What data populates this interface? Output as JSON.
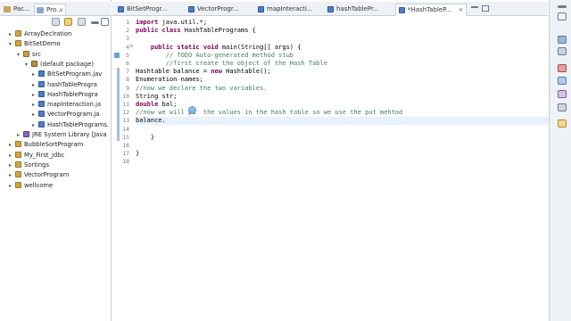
{
  "left_tabs": [
    {
      "label": "Pac..."
    },
    {
      "label": "Pro..."
    }
  ],
  "tree": [
    {
      "label": "ArrayDeclration",
      "level": 0,
      "arrow": "▸",
      "type": "proj"
    },
    {
      "label": "BitSetDemo",
      "level": 0,
      "arrow": "▾",
      "type": "proj"
    },
    {
      "label": "src",
      "level": 1,
      "arrow": "▾",
      "type": "src"
    },
    {
      "label": "(default package)",
      "level": 2,
      "arrow": "▾",
      "type": "pkg"
    },
    {
      "label": "BitSetProgram.jav",
      "level": 3,
      "arrow": "▸",
      "type": "java"
    },
    {
      "label": "hashTableProgra",
      "level": 3,
      "arrow": "▸",
      "type": "java"
    },
    {
      "label": "HashTableProgra",
      "level": 3,
      "arrow": "▸",
      "type": "java"
    },
    {
      "label": "mapInteraction.ja",
      "level": 3,
      "arrow": "▸",
      "type": "java"
    },
    {
      "label": "VectorProgram.ja",
      "level": 3,
      "arrow": "▸",
      "type": "java"
    },
    {
      "label": "HashTablePrograms.",
      "level": 3,
      "arrow": "▸",
      "type": "java"
    },
    {
      "label": "JRE System Library [Java",
      "level": 1,
      "arrow": "▸",
      "type": "lib"
    },
    {
      "label": "BubbleSortProgram",
      "level": 0,
      "arrow": "▸",
      "type": "proj"
    },
    {
      "label": "My_First_jdbc",
      "level": 0,
      "arrow": "▸",
      "type": "proj"
    },
    {
      "label": "Sortings",
      "level": 0,
      "arrow": "▸",
      "type": "proj"
    },
    {
      "label": "VectorProgram",
      "level": 0,
      "arrow": "▸",
      "type": "proj"
    },
    {
      "label": "wellcome",
      "level": 0,
      "arrow": "▸",
      "type": "proj"
    }
  ],
  "editor_tabs": [
    {
      "label": "BitSetProgr...",
      "active": false
    },
    {
      "label": "VectorProgr...",
      "active": false
    },
    {
      "label": "mapInteracti...",
      "active": false
    },
    {
      "label": "hashTablePr...",
      "active": false
    },
    {
      "label": "*HashTableP...",
      "active": true
    }
  ],
  "code_lines": [
    {
      "n": "1",
      "html": "<span class=\"kw\">import</span> java.util.*;"
    },
    {
      "n": "2",
      "html": "<span class=\"kw\">public class</span> HashTablePrograms {"
    },
    {
      "n": "3",
      "html": ""
    },
    {
      "n": "4",
      "html": "    <span class=\"kw\">public static void</span> main(String[] args) {"
    },
    {
      "n": "5",
      "html": "        <span class=\"cm\">// TODO Auto-generated method stub</span>"
    },
    {
      "n": "6",
      "html": "        <span class=\"cm\">//first create the object of the Hash Table</span>"
    },
    {
      "n": "7",
      "html": "Hashtable balance = <span class=\"kw\">new</span> Hashtable();"
    },
    {
      "n": "8",
      "html": "Enumeration names;"
    },
    {
      "n": "9",
      "html": "<span class=\"cm\">//now we declare the two variables.</span>"
    },
    {
      "n": "10",
      "html": "String str;"
    },
    {
      "n": "11",
      "html": "<span class=\"kw\">double</span> bal;"
    },
    {
      "n": "12",
      "html": "<span class=\"cm\">//now we will pu  the values in the hash table so we use the put mehtod</span>"
    },
    {
      "n": "13",
      "html": "balance."
    },
    {
      "n": "14",
      "html": ""
    },
    {
      "n": "15",
      "html": "    }"
    },
    {
      "n": "16",
      "html": ""
    },
    {
      "n": "17",
      "html": "}"
    },
    {
      "n": "18",
      "html": ""
    }
  ],
  "colors": {
    "keyword": "#7f0055",
    "comment": "#3f7f5f",
    "current_line": "#e8f2fe",
    "accent": "#4d7fc4"
  }
}
